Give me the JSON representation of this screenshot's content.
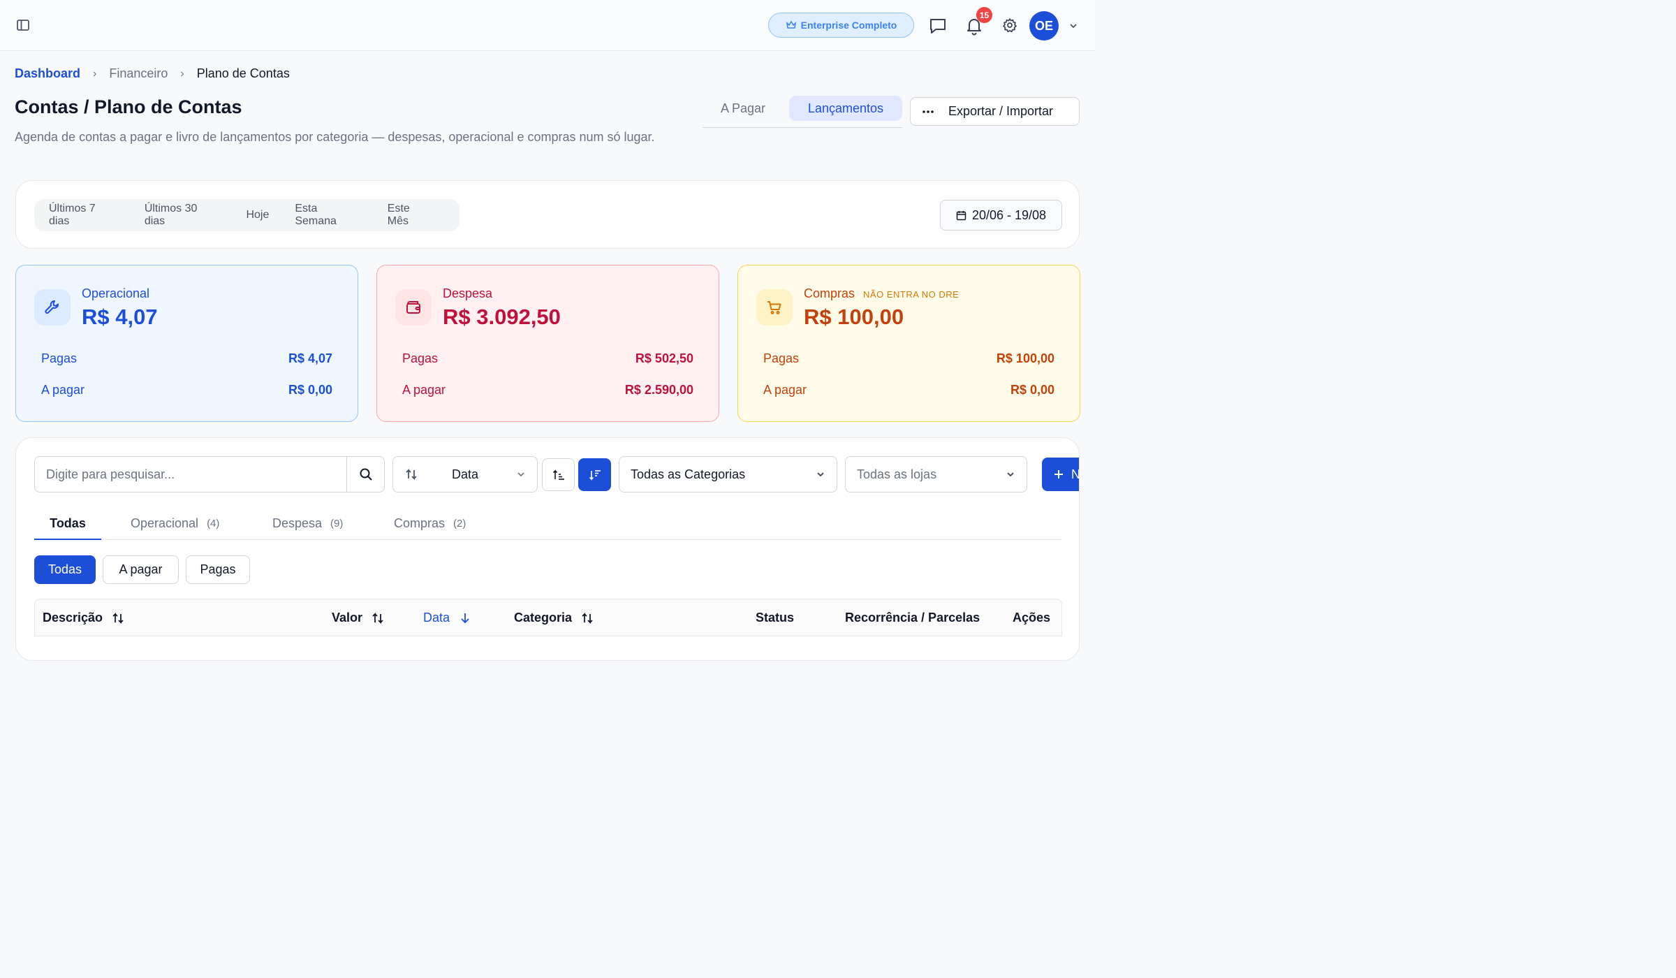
{
  "header": {
    "plan_badge": "Enterprise Completo",
    "notification_count": "15",
    "avatar_initials": "OE"
  },
  "breadcrumb": [
    "Dashboard",
    "Financeiro",
    "Plano de Contas"
  ],
  "page": {
    "title": "Contas / Plano de Contas",
    "description": "Agenda de contas a pagar e livro de lançamentos por categoria — despesas, operacional e compras num só lugar."
  },
  "view_tabs": [
    "A Pagar",
    "Lançamentos"
  ],
  "export_label": "Exportar / Importar",
  "period_filters": [
    "Últimos 7 dias",
    "Últimos 30 dias",
    "Hoje",
    "Esta Semana",
    "Este Mês"
  ],
  "date_range": "20/06 - 19/08",
  "kpis": {
    "operacional": {
      "label": "Operacional",
      "total": "R$ 4,07",
      "pagas_label": "Pagas",
      "pagas": "R$ 4,07",
      "apagar_label": "A pagar",
      "apagar": "R$ 0,00"
    },
    "despesa": {
      "label": "Despesa",
      "total": "R$ 3.092,50",
      "pagas_label": "Pagas",
      "pagas": "R$ 502,50",
      "apagar_label": "A pagar",
      "apagar": "R$ 2.590,00"
    },
    "compras": {
      "label": "Compras",
      "note": "NÃO ENTRA NO DRE",
      "total": "R$ 100,00",
      "pagas_label": "Pagas",
      "pagas": "R$ 100,00",
      "apagar_label": "A pagar",
      "apagar": "R$ 0,00"
    }
  },
  "toolbar": {
    "search_placeholder": "Digite para pesquisar...",
    "sort_field": "Data",
    "category_filter": "Todas as Categorias",
    "store_filter": "Todas as lojas",
    "new_button": "N"
  },
  "type_tabs": [
    {
      "label": "Todas",
      "count": ""
    },
    {
      "label": "Operacional",
      "count": "(4)"
    },
    {
      "label": "Despesa",
      "count": "(9)"
    },
    {
      "label": "Compras",
      "count": "(2)"
    }
  ],
  "status_filters": [
    "Todas",
    "A pagar",
    "Pagas"
  ],
  "table": {
    "columns": [
      "Descrição",
      "Valor",
      "Data",
      "Categoria",
      "Status",
      "Recorrência / Parcelas",
      "Ações"
    ]
  },
  "colors": {
    "primary": "#1d4ed8",
    "operacional": "#1d4ed8",
    "despesa": "#be123c",
    "compras": "#c2410c",
    "notification": "#ef4444"
  }
}
